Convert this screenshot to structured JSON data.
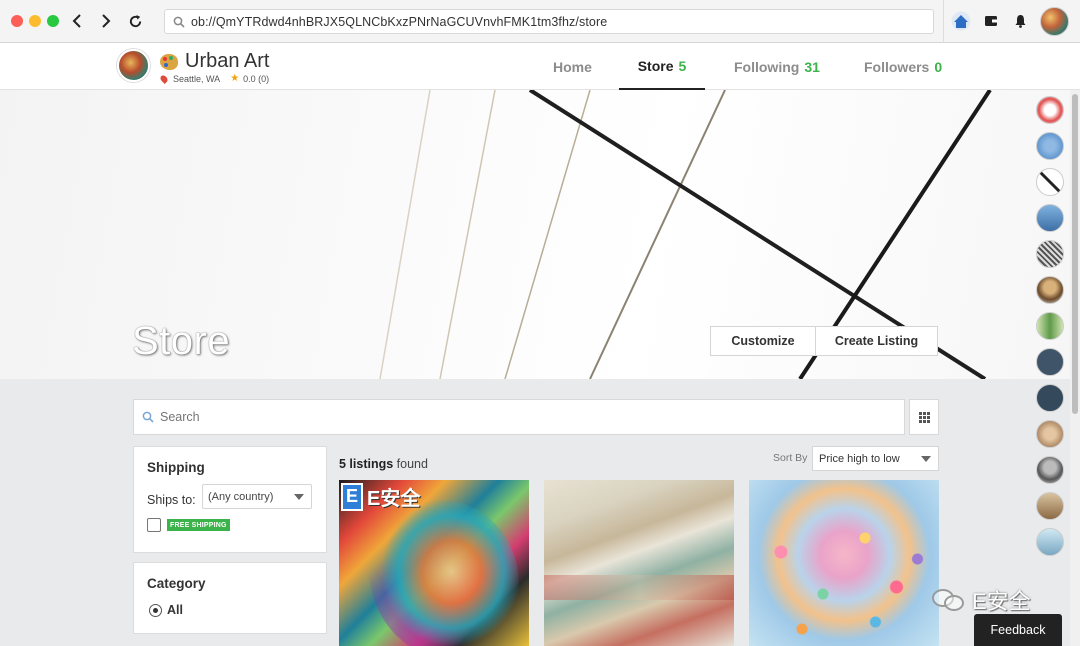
{
  "browser": {
    "url": "ob://QmYTRdwd4nhBRJX5QLNCbKxzPNrNaGCUVnvhFMK1tm3fhz/store",
    "icons": [
      "search-icon",
      "back-icon",
      "forward-icon",
      "reload-icon",
      "home-icon",
      "wallet-icon",
      "bell-icon"
    ]
  },
  "store": {
    "name": "Urban Art",
    "location": "Seattle, WA",
    "rating": "0.0 (0)"
  },
  "nav": {
    "tabs": [
      {
        "label": "Home",
        "count": ""
      },
      {
        "label": "Store",
        "count": "5"
      },
      {
        "label": "Following",
        "count": "31"
      },
      {
        "label": "Followers",
        "count": "0"
      }
    ],
    "active": "Store"
  },
  "banner": {
    "title": "Store",
    "customize_label": "Customize",
    "create_listing_label": "Create Listing"
  },
  "search": {
    "placeholder": "Search"
  },
  "filters": {
    "shipping_title": "Shipping",
    "ships_to_label": "Ships to:",
    "ships_to_value": "(Any country)",
    "free_shipping_label": "FREE SHIPPING",
    "category_title": "Category",
    "category_value": "All"
  },
  "results": {
    "count_text": "5 listings",
    "found_text": "found",
    "sort_label": "Sort By",
    "sort_value": "Price high to low"
  },
  "watermark": {
    "badge_letter": "E",
    "overlay_text": "E安全",
    "brand": "E安全"
  },
  "feedback_label": "Feedback",
  "colors": {
    "accent_green": "#3bb34a",
    "text_dark": "#222222",
    "tab_inactive": "#8c8c8c"
  }
}
